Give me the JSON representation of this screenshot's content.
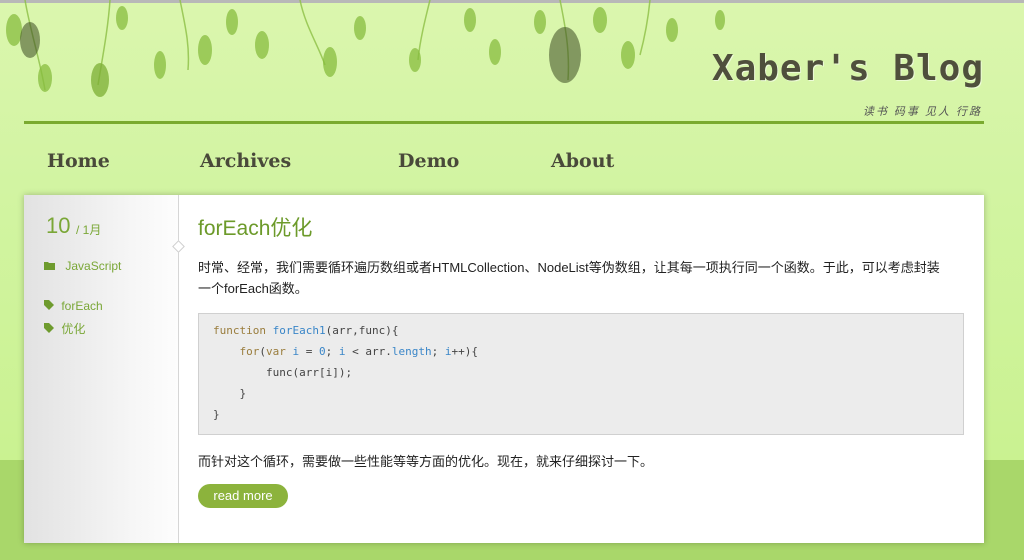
{
  "site": {
    "title": "Xaber's Blog",
    "subtitle": "读书 码事 见人 行路"
  },
  "nav": [
    {
      "label": "Home"
    },
    {
      "label": "Archives"
    },
    {
      "label": "Demo"
    },
    {
      "label": "About"
    }
  ],
  "post": {
    "date_day": "10",
    "date_month": "/ 1月",
    "category": "JavaScript",
    "tags": [
      "forEach",
      "优化"
    ],
    "title": "forEach优化",
    "intro_line1": "时常、经常，我们需要循环遍历数组或者HTMLCollection、NodeList等伪数组，让其每一项执行同一个函数。于此，可以考虑封装",
    "intro_line2": "一个forEach函数。",
    "code_lines": [
      "function forEach1(arr,func){",
      "    for(var i = 0; i < arr.length; i++){",
      "        func(arr[i]);",
      "    }",
      "}"
    ],
    "outro": "而针对这个循环，需要做一些性能等等方面的优化。现在，就来仔细探讨一下。",
    "read_more": "read more"
  },
  "colors": {
    "accent": "#7aa737",
    "button": "#8cb33c",
    "background": "#cff29a",
    "title": "#4f4f3c"
  },
  "icons": {
    "category": "folder-icon",
    "tag": "tag-icon"
  }
}
